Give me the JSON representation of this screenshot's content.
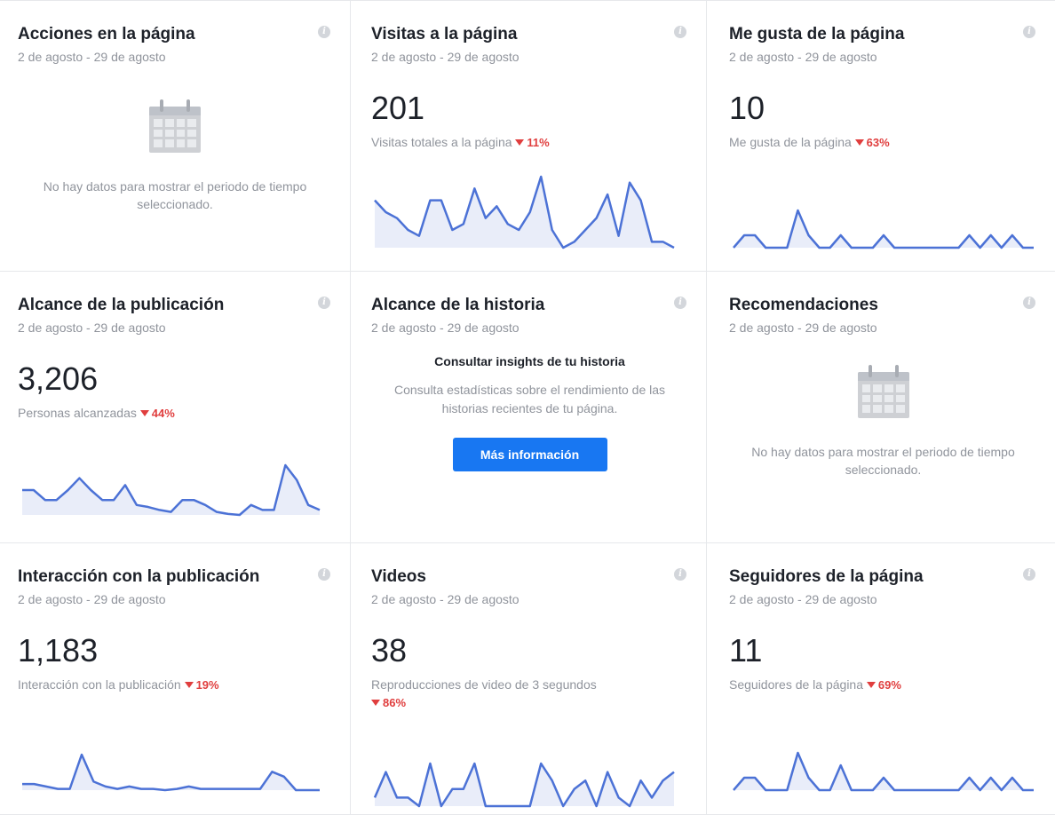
{
  "date_range": "2 de agosto - 29 de agosto",
  "info_icon": "info-icon",
  "empty_message": "No hay datos para mostrar el periodo de tiempo seleccionado.",
  "colors": {
    "line": "#4c72d6",
    "fill": "#e9edf9",
    "decrease": "#e03e3e",
    "button": "#1877f2"
  },
  "cards": {
    "acciones": {
      "title": "Acciones en la página"
    },
    "visitas": {
      "title": "Visitas a la página",
      "value": "201",
      "label": "Visitas totales a la página",
      "change": "11%",
      "series": [
        8,
        6,
        5,
        3,
        2,
        8,
        8,
        3,
        4,
        10,
        5,
        7,
        4,
        3,
        6,
        12,
        3,
        0,
        1,
        3,
        5,
        9,
        2,
        11,
        8,
        1,
        1,
        0
      ]
    },
    "megusta": {
      "title": "Me gusta de la página",
      "value": "10",
      "label": "Me gusta de la página",
      "change": "63%",
      "series": [
        0,
        1,
        1,
        0,
        0,
        0,
        3,
        1,
        0,
        0,
        1,
        0,
        0,
        0,
        1,
        0,
        0,
        0,
        0,
        0,
        0,
        0,
        1,
        0,
        1,
        0,
        1,
        0,
        0
      ]
    },
    "alcance_pub": {
      "title": "Alcance de la publicación",
      "value": "3,206",
      "label": "Personas alcanzadas",
      "change": "44%",
      "series": [
        300,
        300,
        200,
        200,
        300,
        420,
        300,
        200,
        200,
        350,
        150,
        130,
        100,
        80,
        200,
        200,
        150,
        80,
        60,
        50,
        150,
        100,
        100,
        550,
        400,
        150,
        100
      ]
    },
    "historia": {
      "title": "Alcance de la historia",
      "heading": "Consultar insights de tu historia",
      "text": "Consulta estadísticas sobre el rendimiento de las historias recientes de tu página.",
      "button": "Más información"
    },
    "recomendaciones": {
      "title": "Recomendaciones"
    },
    "interaccion": {
      "title": "Interacción con la publicación",
      "value": "1,183",
      "label": "Interacción con la publicación",
      "change": "19%",
      "series": [
        30,
        30,
        20,
        10,
        10,
        150,
        40,
        20,
        10,
        20,
        10,
        10,
        5,
        10,
        20,
        10,
        10,
        10,
        10,
        10,
        10,
        80,
        60,
        5,
        5,
        5
      ]
    },
    "videos": {
      "title": "Videos",
      "value": "38",
      "label": "Reproducciones de video de 3 segundos",
      "change": "86%",
      "series": [
        1,
        4,
        1,
        1,
        0,
        5,
        0,
        2,
        2,
        5,
        0,
        0,
        0,
        0,
        0,
        5,
        3,
        0,
        2,
        3,
        0,
        4,
        1,
        0,
        3,
        1,
        3,
        4
      ]
    },
    "seguidores": {
      "title": "Seguidores de la página",
      "value": "11",
      "label": "Seguidores de la página",
      "change": "69%",
      "series": [
        0,
        1,
        1,
        0,
        0,
        0,
        3,
        1,
        0,
        0,
        2,
        0,
        0,
        0,
        1,
        0,
        0,
        0,
        0,
        0,
        0,
        0,
        1,
        0,
        1,
        0,
        1,
        0,
        0
      ]
    }
  }
}
